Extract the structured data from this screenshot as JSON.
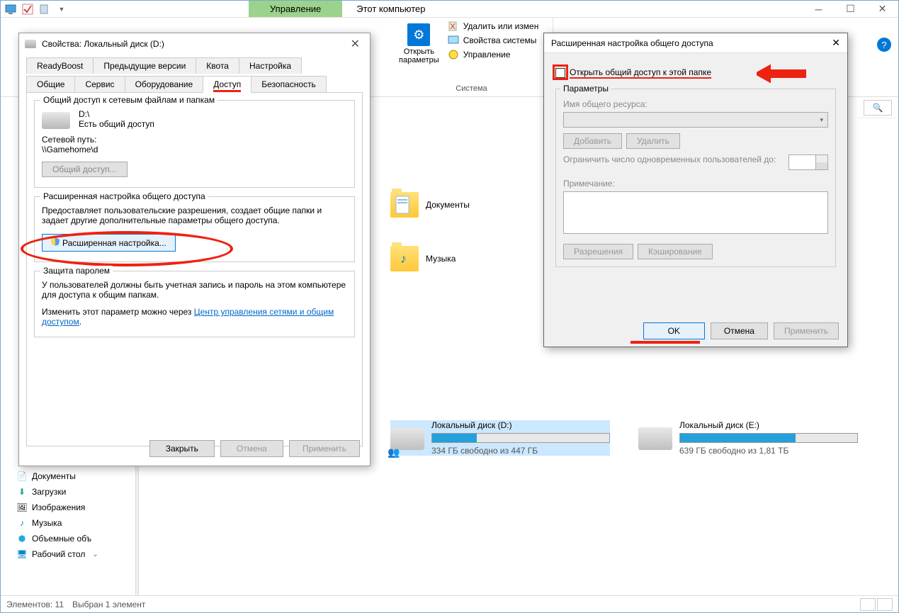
{
  "explorer": {
    "tab_manage": "Управление",
    "tab_title": "Этот компьютер",
    "ribbon": {
      "open_params": "Открыть\nпараметры",
      "delete_change": "Удалить или измен",
      "sys_props": "Свойства системы",
      "manage": "Управление",
      "group_label": "Система"
    }
  },
  "nav": {
    "docs": "Документы",
    "downloads": "Загрузки",
    "images": "Изображения",
    "music": "Музыка",
    "volumes": "Объемные объ",
    "desktop": "Рабочий стол"
  },
  "content": {
    "folder_docs": "Документы",
    "folder_music": "Музыка",
    "drive_d": {
      "label": "Локальный диск (D:)",
      "sub": "334 ГБ свободно из 447 ГБ",
      "fill": 25
    },
    "drive_e": {
      "label": "Локальный диск (E:)",
      "sub": "639 ГБ свободно из 1,81 ТБ",
      "fill": 65
    }
  },
  "status": {
    "count": "Элементов: 11",
    "selected": "Выбран 1 элемент"
  },
  "props": {
    "title": "Свойства: Локальный диск (D:)",
    "tabs": {
      "readyboost": "ReadyBoost",
      "prev": "Предыдущие версии",
      "quota": "Квота",
      "settings": "Настройка",
      "general": "Общие",
      "service": "Сервис",
      "hardware": "Оборудование",
      "access": "Доступ",
      "security": "Безопасность"
    },
    "fs1_legend": "Общий доступ к сетевым файлам и папкам",
    "path": "D:\\",
    "shared": "Есть общий доступ",
    "netpath_label": "Сетевой путь:",
    "netpath": "\\\\Gamehome\\d",
    "share_btn": "Общий доступ...",
    "fs2_legend": "Расширенная настройка общего доступа",
    "fs2_text": "Предоставляет пользовательские разрешения, создает общие папки и задает другие дополнительные параметры общего доступа.",
    "adv_btn": "Расширенная настройка...",
    "fs3_legend": "Защита паролем",
    "fs3_text": "У пользователей должны быть учетная запись и пароль на этом компьютере для доступа к общим папкам.",
    "fs3_text2": "Изменить этот параметр можно через ",
    "fs3_link": "Центр управления сетями и общим доступом",
    "close": "Закрыть",
    "cancel": "Отмена",
    "apply": "Применить"
  },
  "adv": {
    "title": "Расширенная настройка общего доступа",
    "checkbox": "Открыть общий доступ к этой папке",
    "params_legend": "Параметры",
    "res_name": "Имя общего ресурса:",
    "add": "Добавить",
    "delete": "Удалить",
    "limit": "Ограничить число одновременных пользователей до:",
    "note": "Примечание:",
    "perms": "Разрешения",
    "cache": "Кэширование",
    "ok": "OK",
    "cancel": "Отмена",
    "apply": "Применить"
  }
}
